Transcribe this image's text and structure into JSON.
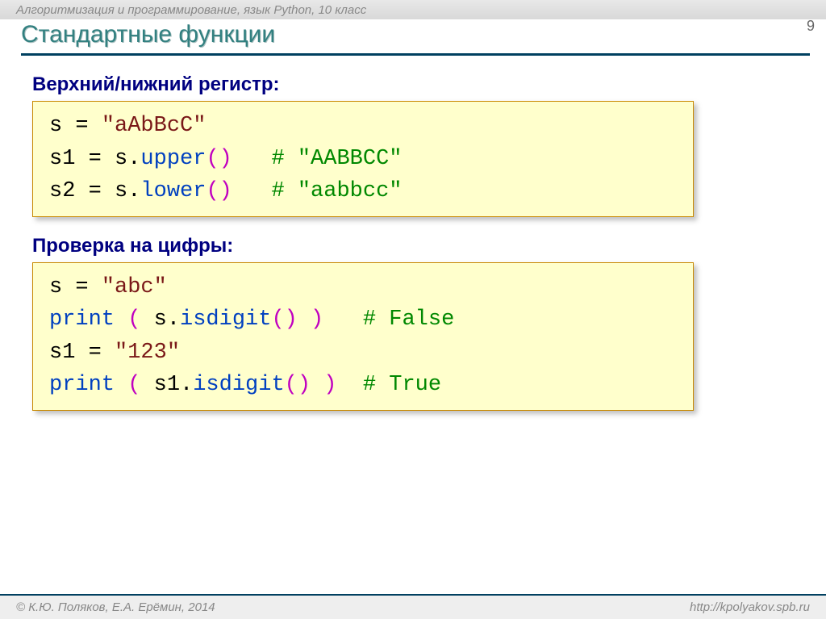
{
  "header": {
    "course_title": "Алгоритмизация и программирование, язык Python, 10 класс",
    "page_number": "9",
    "slide_title": "Стандартные функции"
  },
  "section1": {
    "label": "Верхний/нижний регистр:",
    "line1": {
      "pre": "s = ",
      "str": "\"aAbBcC\""
    },
    "line2": {
      "pre": "s1 = s.",
      "method": "upper",
      "paren": "()",
      "gap": "   ",
      "comment": "# \"AABBCC\""
    },
    "line3": {
      "pre": "s2 = s.",
      "method": "lower",
      "paren": "()",
      "gap": "   ",
      "comment": "# \"aabbcc\""
    }
  },
  "section2": {
    "label": "Проверка на цифры:",
    "line1": {
      "pre": "s = ",
      "str": "\"abc\""
    },
    "line2": {
      "print": "print",
      "open": " ( ",
      "obj": "s.",
      "method": "isdigit",
      "mparen": "()",
      "close": " )",
      "gap": "   ",
      "comment": "# False"
    },
    "line3": {
      "pre": "s1 = ",
      "str": "\"123\""
    },
    "line4": {
      "print": "print",
      "open": " ( ",
      "obj": "s1.",
      "method": "isdigit",
      "mparen": "()",
      "close": " )",
      "gap": "  ",
      "comment": "# True"
    }
  },
  "footer": {
    "left": "© К.Ю. Поляков, Е.А. Ерёмин, 2014",
    "right": "http://kpolyakov.spb.ru"
  }
}
